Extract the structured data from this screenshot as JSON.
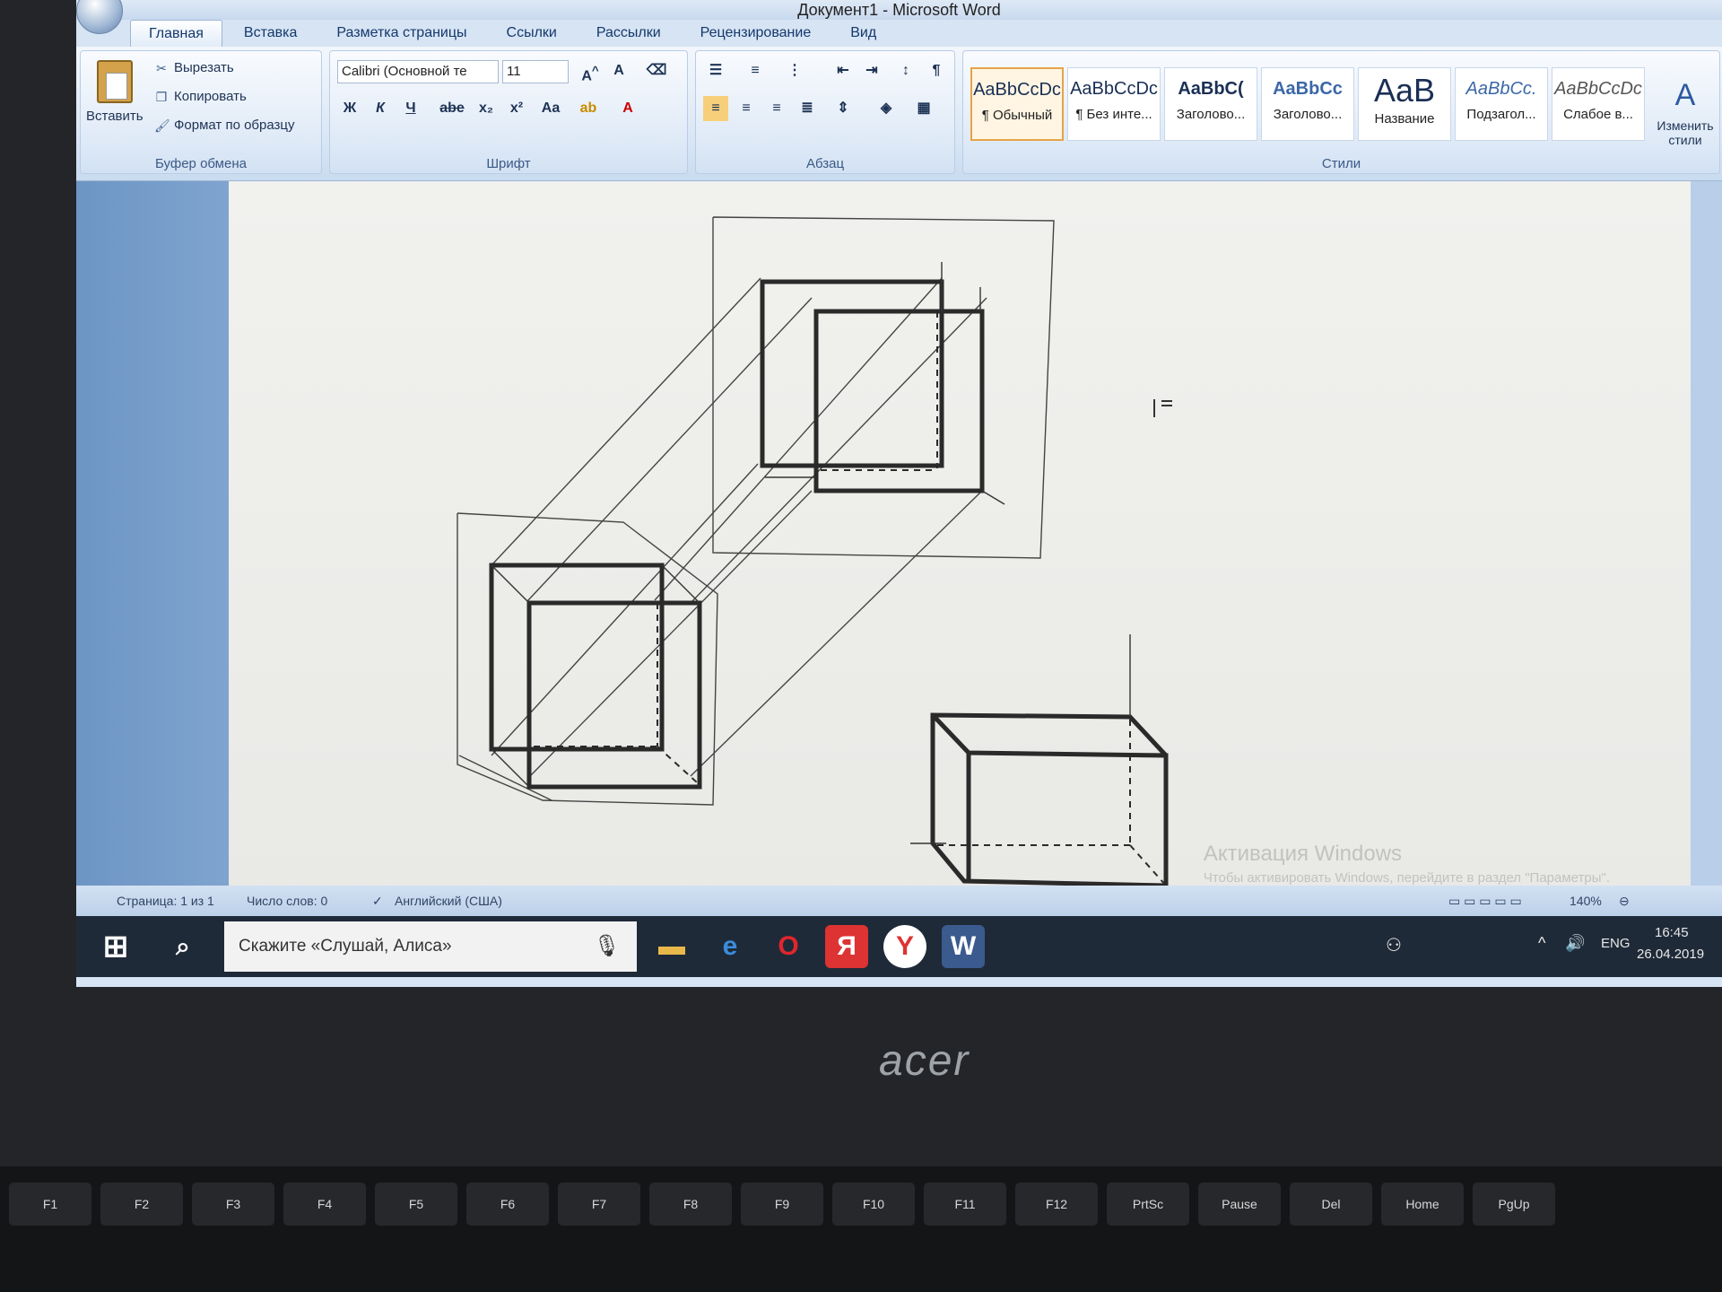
{
  "window": {
    "title": "Документ1 - Microsoft Word"
  },
  "tabs": [
    "Главная",
    "Вставка",
    "Разметка страницы",
    "Ссылки",
    "Рассылки",
    "Рецензирование",
    "Вид"
  ],
  "clipboard": {
    "paste": "Вставить",
    "cut": "Вырезать",
    "copy": "Копировать",
    "format_painter": "Формат по образцу",
    "label": "Буфер обмена"
  },
  "font": {
    "name": "Calibri (Основной те",
    "size": "11",
    "label": "Шрифт",
    "bold": "Ж",
    "italic": "К",
    "underline": "Ч",
    "strike": "abe",
    "sub": "x₂",
    "sup": "x²",
    "case": "Aa"
  },
  "paragraph": {
    "label": "Абзац"
  },
  "styles": {
    "label": "Стили",
    "items": [
      {
        "sample": "AaBbCcDc",
        "name": "¶ Обычный"
      },
      {
        "sample": "AaBbCcDc",
        "name": "¶ Без инте..."
      },
      {
        "sample": "AaBbC(",
        "name": "Заголово..."
      },
      {
        "sample": "AaBbCc",
        "name": "Заголово..."
      },
      {
        "sample": "AaB",
        "name": "Название"
      },
      {
        "sample": "AaBbCc.",
        "name": "Подзагол..."
      },
      {
        "sample": "AaBbCcDc",
        "name": "Слабое в..."
      }
    ],
    "change": "Изменить стили"
  },
  "status": {
    "page": "Страница: 1 из 1",
    "words": "Число слов: 0",
    "lang": "Английский (США)",
    "zoom": "140%"
  },
  "watermark": {
    "line1": "Активация Windows",
    "line2": "Чтобы активировать Windows, перейдите в раздел \"Параметры\"."
  },
  "taskbar": {
    "search_placeholder": "Скажите «Слушай, Алиса»",
    "lang": "ENG",
    "time": "16:45",
    "date": "26.04.2019"
  },
  "laptop": {
    "brand": "acer"
  },
  "keys": [
    "F1",
    "F2",
    "F3",
    "F4",
    "F5",
    "F6",
    "F7",
    "F8",
    "F9",
    "F10",
    "F11",
    "F12",
    "PrtSc",
    "Pause",
    "Del",
    "Home",
    "PgUp"
  ]
}
